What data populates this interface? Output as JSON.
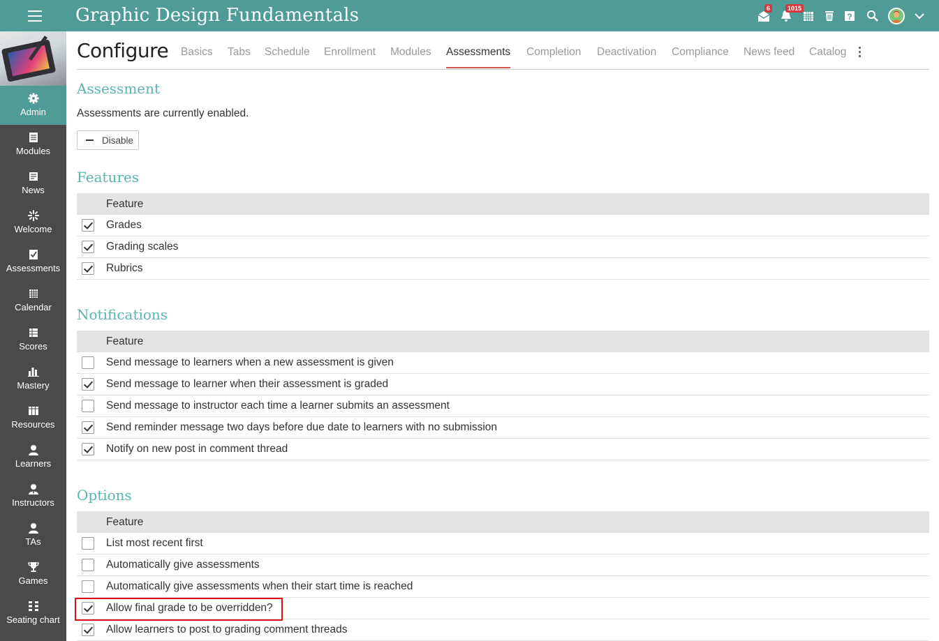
{
  "topbar": {
    "course_title": "Graphic Design Fundamentals",
    "messages_badge": "6",
    "notifications_badge": "1015",
    "accent_color": "#4f9c96"
  },
  "sidebar": {
    "items": [
      {
        "label": "Admin",
        "icon": "gear-icon",
        "active": true
      },
      {
        "label": "Modules",
        "icon": "modules-icon"
      },
      {
        "label": "News",
        "icon": "news-icon"
      },
      {
        "label": "Welcome",
        "icon": "welcome-icon"
      },
      {
        "label": "Assessments",
        "icon": "assessments-icon"
      },
      {
        "label": "Calendar",
        "icon": "calendar-icon"
      },
      {
        "label": "Scores",
        "icon": "scores-icon"
      },
      {
        "label": "Mastery",
        "icon": "mastery-icon"
      },
      {
        "label": "Resources",
        "icon": "resources-icon"
      },
      {
        "label": "Learners",
        "icon": "learners-icon"
      },
      {
        "label": "Instructors",
        "icon": "instructors-icon"
      },
      {
        "label": "TAs",
        "icon": "tas-icon"
      },
      {
        "label": "Games",
        "icon": "trophy-icon"
      },
      {
        "label": "Seating chart",
        "icon": "seating-chart-icon"
      }
    ]
  },
  "config": {
    "title": "Configure",
    "tabs": [
      "Basics",
      "Tabs",
      "Schedule",
      "Enrollment",
      "Modules",
      "Assessments",
      "Completion",
      "Deactivation",
      "Compliance",
      "News feed",
      "Catalog"
    ],
    "active_tab": "Assessments"
  },
  "assessment": {
    "title": "Assessment",
    "status": "Assessments are currently enabled.",
    "disable_label": "Disable"
  },
  "features": {
    "title": "Features",
    "header": "Feature",
    "rows": [
      {
        "label": "Grades",
        "checked": true
      },
      {
        "label": "Grading scales",
        "checked": true
      },
      {
        "label": "Rubrics",
        "checked": true
      }
    ]
  },
  "notifications": {
    "title": "Notifications",
    "header": "Feature",
    "rows": [
      {
        "label": "Send message to learners when a new assessment is given",
        "checked": false
      },
      {
        "label": "Send message to learner when their assessment is graded",
        "checked": true
      },
      {
        "label": "Send message to instructor each time a learner submits an assessment",
        "checked": false
      },
      {
        "label": "Send reminder message two days before due date to learners with no submission",
        "checked": true
      },
      {
        "label": "Notify on new post in comment thread",
        "checked": true
      }
    ]
  },
  "options": {
    "title": "Options",
    "header": "Feature",
    "rows": [
      {
        "label": "List most recent first",
        "checked": false
      },
      {
        "label": "Automatically give assessments",
        "checked": false
      },
      {
        "label": "Automatically give assessments when their start time is reached",
        "checked": false
      },
      {
        "label": "Allow final grade to be overridden?",
        "checked": true
      },
      {
        "label": "Allow learners to post to grading comment threads",
        "checked": true
      }
    ]
  }
}
